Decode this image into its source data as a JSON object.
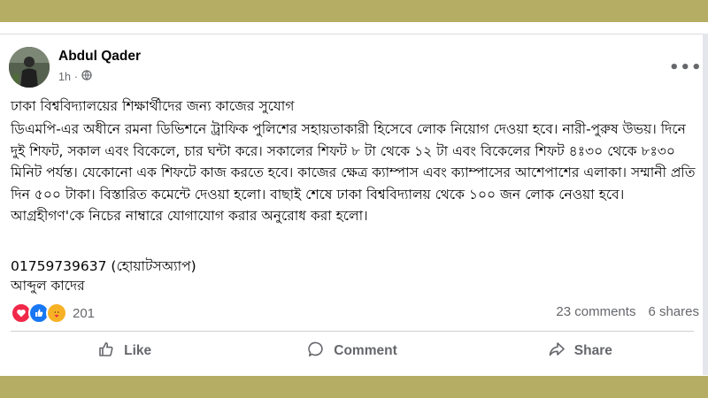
{
  "colors": {
    "band": "#b5ad63",
    "text": "#050505",
    "muted": "#65676b",
    "love": "#f02849",
    "like": "#1877f2",
    "care": "#f7b125"
  },
  "post": {
    "author": "Abdul Qader",
    "time": "1h",
    "title": "ঢাকা বিশ্ববিদ্যালয়ের শিক্ষার্থীদের জন্য কাজের সুযোগ",
    "body": "ডিএমপি-এর অধীনে রমনা ডিভিশনে ট্রাফিক পুলিশের সহায়তাকারী হিসেবে লোক নিয়োগ দেওয়া হবে। নারী-পুরুষ উভয়। দিনে দুই শিফট, সকাল এবং বিকেলে, চার ঘন্টা করে। সকালের শিফট ৮ টা থেকে ১২ টা এবং বিকেলের শিফট ৪ঃ৩০ থেকে ৮ঃ৩০ মিনিট পর্যন্ত। যেকোনো এক শিফটে কাজ করতে হবে। কাজের ক্ষেত্র ক্যাম্পাস এবং ক্যাম্পাসের আশেপাশের এলাকা। সম্মানী প্রতি দিন ৫০০ টাকা। বিস্তারিত কমেন্টে দেওয়া হলো। বাছাই শেষে ঢাকা বিশ্ববিদ্যালয় থেকে ১০০ জন লোক নেওয়া হবে। আগ্রহীগণ'কে নিচের নাম্বারে যোগাযোগ করার অনুরোধ করা হলো।",
    "phone": "01759739637 (হোয়াটসঅ্যাপ)",
    "signature": "আব্দুল কাদের"
  },
  "stats": {
    "reactions": "201",
    "comments": "23 comments",
    "shares": "6 shares"
  },
  "actions": {
    "like": "Like",
    "comment": "Comment",
    "share": "Share"
  },
  "icons": [
    "globe-icon",
    "more-icon",
    "love-reaction-icon",
    "like-reaction-icon",
    "care-reaction-icon",
    "like-icon",
    "comment-icon",
    "share-icon"
  ]
}
